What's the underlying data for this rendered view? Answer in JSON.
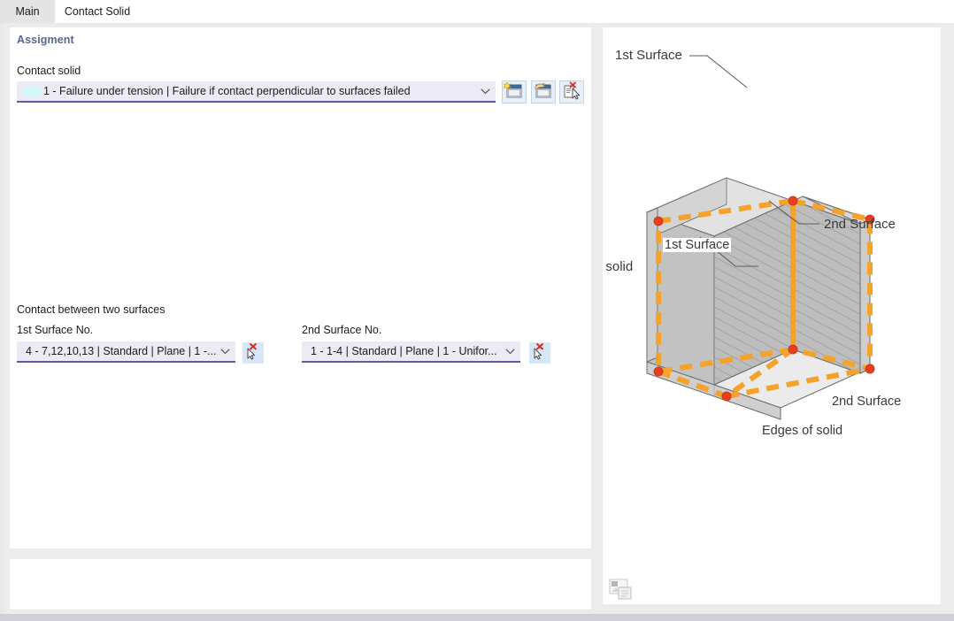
{
  "tabs": [
    {
      "label": "Main",
      "active": false
    },
    {
      "label": "Contact Solid",
      "active": true
    }
  ],
  "left_panel": {
    "section_heading": "Assigment",
    "contact_solid": {
      "label": "Contact solid",
      "value": "1 - Failure under tension | Failure if contact perpendicular to surfaces failed",
      "swatch_color": "#d5f6f8",
      "buttons": [
        {
          "name": "new-contact-solid-button",
          "tooltip": "New"
        },
        {
          "name": "edit-contact-solid-button",
          "tooltip": "Edit"
        },
        {
          "name": "pick-contact-solid-button",
          "tooltip": "Select"
        }
      ]
    },
    "contact_between": {
      "group_label": "Contact between two surfaces",
      "first_surface": {
        "label": "1st Surface No.",
        "value": "4 - 7,12,10,13 | Standard | Plane | 1 -..."
      },
      "second_surface": {
        "label": "2nd Surface No.",
        "value": "1 - 1-4 | Standard | Plane | 1 - Unifor..."
      }
    }
  },
  "right_panel": {
    "diagram": {
      "labels": {
        "first_surface": "1st Surface",
        "second_surface": "2nd Surface",
        "edges_of_solid": "Edges of solid"
      },
      "colors": {
        "highlight_edge": "#f5a22a",
        "node_point": "#e8401f",
        "solid_face": "#b9b9b9",
        "solid_outline": "#6d6d6d",
        "label_text": "#3a3a3a"
      }
    },
    "image_copy_icon": "copy-image-icon"
  },
  "theme": {
    "window_background": "#ececec",
    "panel_background": "#ffffff",
    "heading_color": "#58688c",
    "combo_background": "#eceaf4",
    "combo_underline": "#5b5ba4",
    "pick_button_background": "#d7e7f7"
  }
}
